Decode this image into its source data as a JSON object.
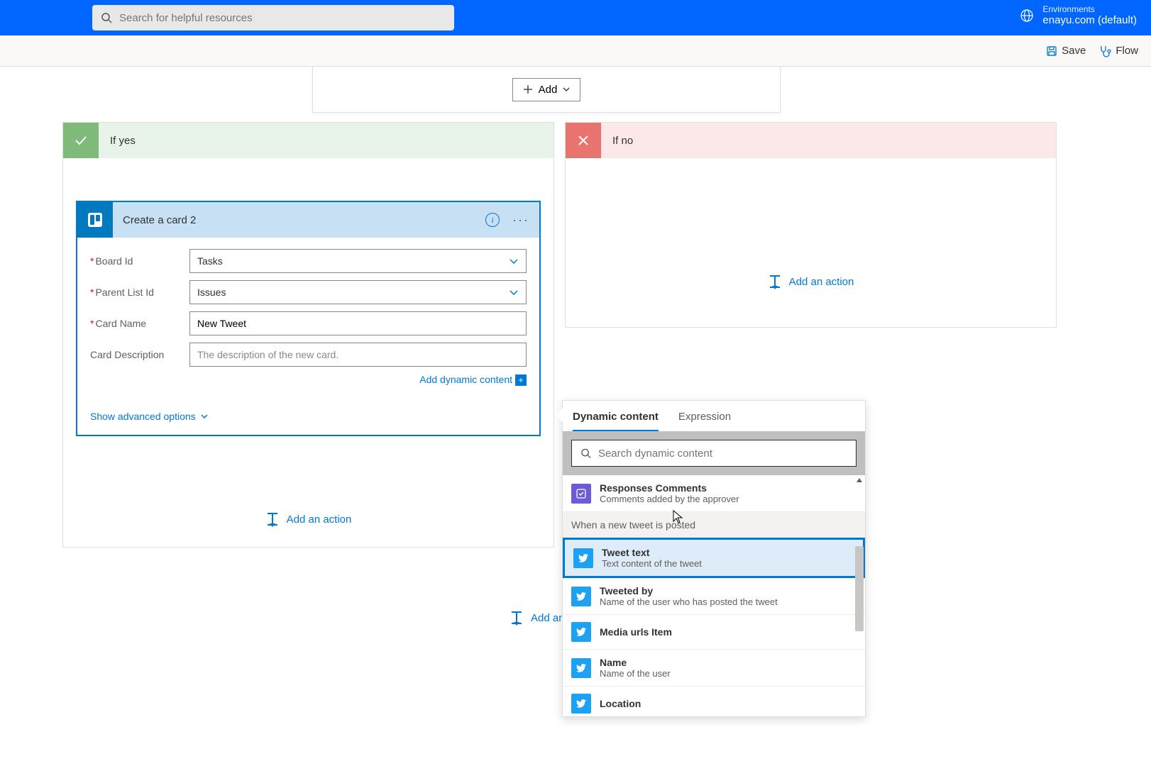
{
  "header": {
    "search_placeholder": "Search for helpful resources",
    "env_label": "Environments",
    "env_name": "enayu.com (default)"
  },
  "toolbar": {
    "save": "Save",
    "flow": "Flow"
  },
  "add_box": {
    "add_label": "Add"
  },
  "branches": {
    "yes": {
      "title": "If yes"
    },
    "no": {
      "title": "If no"
    }
  },
  "trello": {
    "title": "Create a card 2",
    "fields": {
      "board_label": "Board Id",
      "board_value": "Tasks",
      "parent_label": "Parent List Id",
      "parent_value": "Issues",
      "name_label": "Card Name",
      "name_value": "New Tweet",
      "desc_label": "Card Description",
      "desc_placeholder": "The description of the new card."
    },
    "dyn_link": "Add dynamic content",
    "adv_opts": "Show advanced options"
  },
  "add_action": "Add an action",
  "add_action_short": "Add an a",
  "dynamic_panel": {
    "tab_dynamic": "Dynamic content",
    "tab_expression": "Expression",
    "search_placeholder": "Search dynamic content",
    "section_trigger": "When a new tweet is posted",
    "items": [
      {
        "name": "Responses Comments",
        "desc": "Comments added by the approver",
        "icon": "approvals"
      },
      {
        "name": "Tweet text",
        "desc": "Text content of the tweet",
        "icon": "twitter",
        "highlighted": true
      },
      {
        "name": "Tweeted by",
        "desc": "Name of the user who has posted the tweet",
        "icon": "twitter"
      },
      {
        "name": "Media urls Item",
        "desc": "",
        "icon": "twitter"
      },
      {
        "name": "Name",
        "desc": "Name of the user",
        "icon": "twitter"
      },
      {
        "name": "Location",
        "desc": "",
        "icon": "twitter"
      }
    ]
  }
}
